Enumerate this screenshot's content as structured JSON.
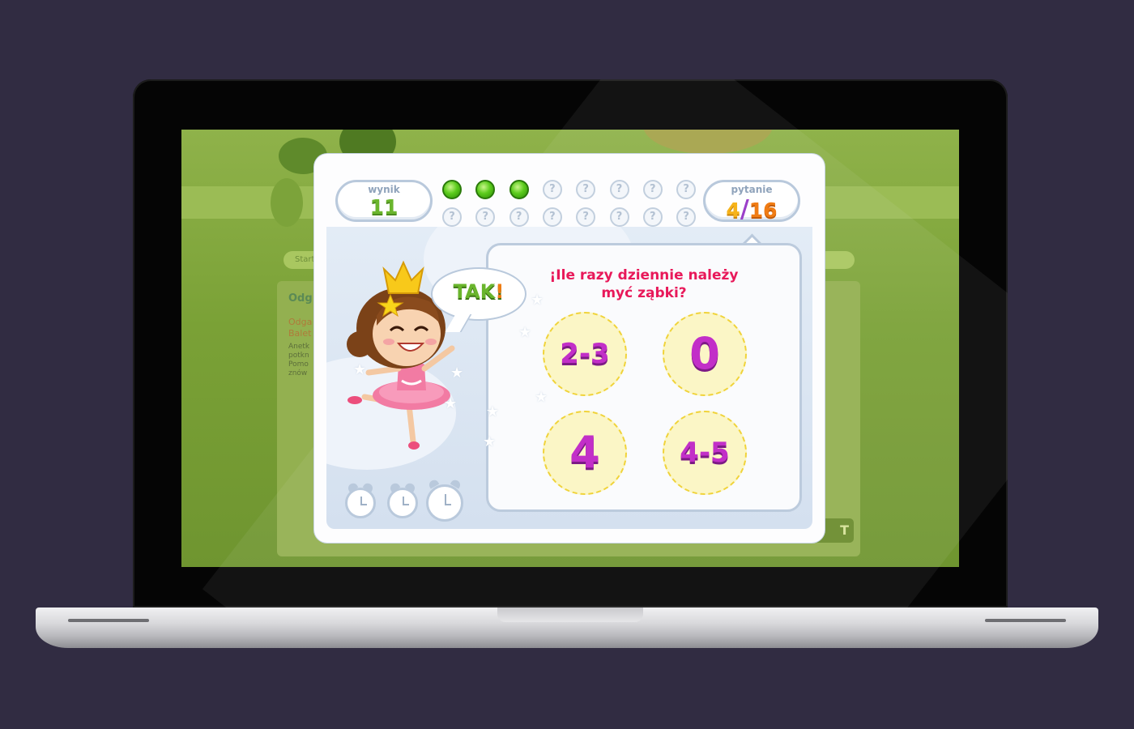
{
  "background_partial": {
    "nav_text": "Start",
    "panel_title": "Odg",
    "panel_text": [
      "Odga",
      "Balet"
    ],
    "panel_small_text": [
      "Anetk",
      "potkn",
      "Pomo",
      "znów"
    ],
    "sign_text": "T"
  },
  "game": {
    "score": {
      "label": "wynik",
      "value": "11"
    },
    "question_counter": {
      "label": "pytanie",
      "current": "4",
      "separator": "/",
      "total": "16"
    },
    "progress": {
      "answered": 3,
      "total": 16,
      "slots_top": [
        "done",
        "done",
        "done",
        "?",
        "?",
        "?",
        "?",
        "?"
      ],
      "slots_bottom": [
        "?",
        "?",
        "?",
        "?",
        "?",
        "?",
        "?",
        "?"
      ]
    },
    "feedback": {
      "text": "TAK",
      "mark": "!"
    },
    "question": {
      "line1": "Ile razy dziennie należy",
      "line2": "myć ząbki?",
      "lead": "¡"
    },
    "answers": [
      {
        "id": "a1",
        "label": "2-3"
      },
      {
        "id": "a2",
        "label": "0"
      },
      {
        "id": "a3",
        "label": "4"
      },
      {
        "id": "a4",
        "label": "4-5"
      }
    ],
    "timers": 3,
    "colors": {
      "score": "#6ab52d",
      "question_text": "#e8195a",
      "answer_text": "#c22fc8",
      "answer_fill": "#fbf6c6",
      "progress_done": "#5ccc1d",
      "counter_current": "#f6b31a",
      "counter_total": "#f07c14"
    },
    "character": "ballerina-princess"
  }
}
